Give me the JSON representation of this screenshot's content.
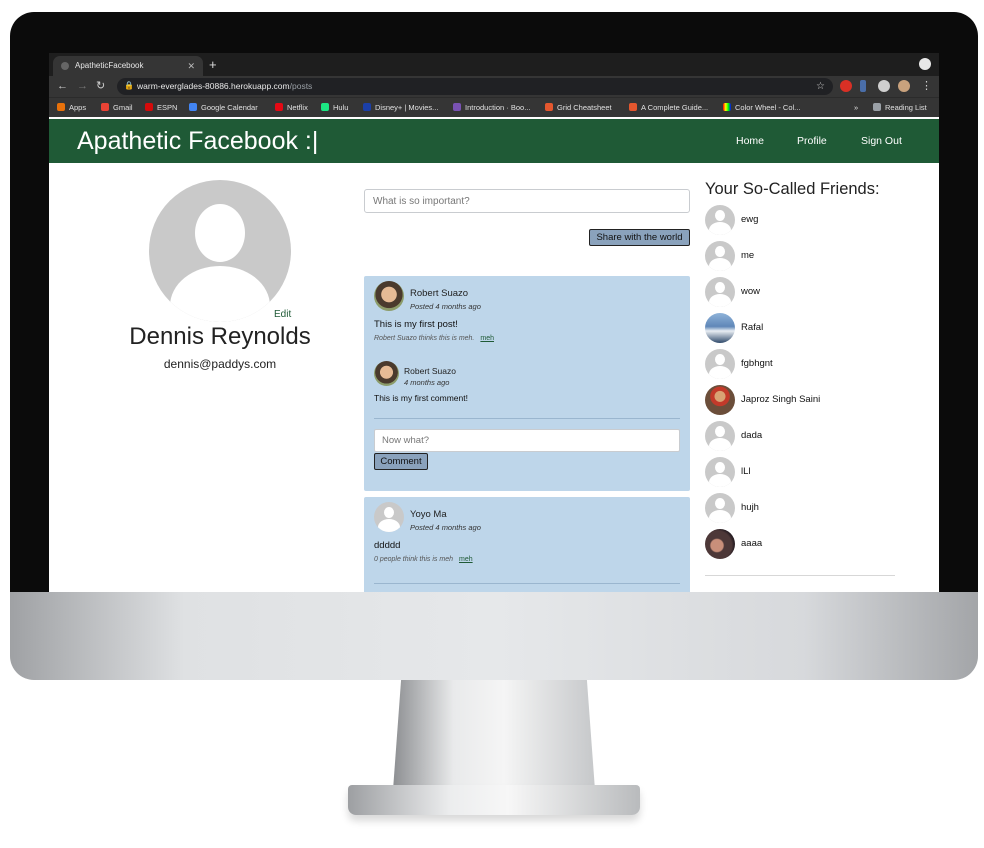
{
  "browser": {
    "tab_title": "ApatheticFacebook",
    "url_host": "warm-everglades-80886.herokuapp.com",
    "url_path": "/posts",
    "bookmarks": [
      "Apps",
      "Gmail",
      "ESPN",
      "Google Calendar",
      "Netflix",
      "Hulu",
      "Disney+ | Movies...",
      "Introduction · Boo...",
      "Grid Cheatsheet",
      "A Complete Guide...",
      "Color Wheel - Col..."
    ],
    "reading_list": "Reading List",
    "more_bookmarks": "»"
  },
  "navbar": {
    "brand": "Apathetic Facebook :|",
    "links": [
      "Home",
      "Profile",
      "Sign Out"
    ],
    "color": "#1f5a36"
  },
  "profile": {
    "edit_label": "Edit",
    "name": "Dennis Reynolds",
    "email": "dennis@paddys.com"
  },
  "composer": {
    "placeholder": "What is so important?",
    "share_label": "Share with the world"
  },
  "posts": [
    {
      "author": "Robert Suazo",
      "meta": "Posted 4 months ago",
      "text": "This is my first post!",
      "likes": "Robert Suazo thinks this is meh.",
      "meh_label": "meh",
      "comments": [
        {
          "author": "Robert Suazo",
          "meta": "4 months ago",
          "text": "This is my first comment!"
        }
      ],
      "comment_placeholder": "Now what?",
      "comment_label": "Comment"
    },
    {
      "author": "Yoyo Ma",
      "meta": "Posted 4 months ago",
      "text": "ddddd",
      "likes": "0 people think this is meh",
      "meh_label": "meh"
    }
  ],
  "friends": {
    "title": "Your So-Called Friends:",
    "list": [
      "ewg",
      "me",
      "wow",
      "Rafal",
      "fgbhgnt",
      "Japroz Singh Saini",
      "dada",
      "lLl",
      "hujh",
      "aaaa"
    ]
  },
  "colors": {
    "card": "#bed6ea",
    "button": "#8aa2bc"
  }
}
